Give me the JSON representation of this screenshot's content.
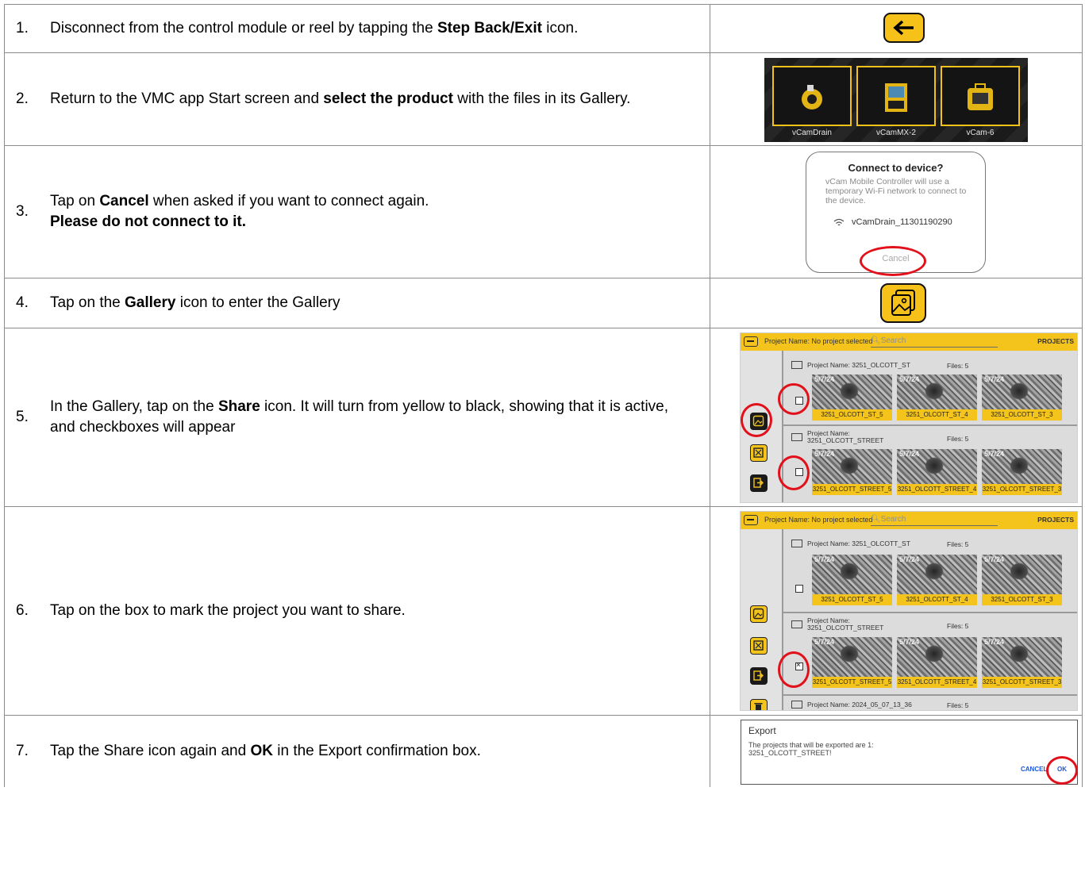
{
  "steps": [
    {
      "num": "1.",
      "text_parts": [
        "Disconnect from the control module or reel by tapping the ",
        "Step Back/Exit",
        " icon."
      ]
    },
    {
      "num": "2.",
      "text_parts": [
        "Return to the VMC app Start screen and ",
        "select the product",
        " with the files in its Gallery."
      ]
    },
    {
      "num": "3.",
      "text_parts": [
        "Tap on ",
        "Cancel",
        " when asked if you want to connect again.",
        "Please do not connect to it."
      ]
    },
    {
      "num": "4.",
      "text_parts": [
        "Tap on the ",
        "Gallery",
        " icon to enter the Gallery"
      ]
    },
    {
      "num": "5.",
      "text_parts": [
        "In the Gallery, tap on the ",
        "Share",
        " icon. It will turn from yellow to black, showing that it is active, and checkboxes will appear"
      ]
    },
    {
      "num": "6.",
      "text": "Tap on the box to mark the project you want to share."
    },
    {
      "num": "7.",
      "text_parts": [
        "Tap the Share icon again and ",
        "OK",
        " in the Export confirmation box."
      ]
    }
  ],
  "products": [
    "vCamDrain",
    "vCamMX-2",
    "vCam-6"
  ],
  "connect_dialog": {
    "title": "Connect to device?",
    "body": "vCam Mobile Controller will use a temporary Wi-Fi network to connect to the device.",
    "network": "vCamDrain_11301190290",
    "cancel": "Cancel"
  },
  "gallery": {
    "header_name": "Project Name: No project selected",
    "search_placeholder": "Search",
    "projects_label": "PROJECTS",
    "date": "5/7/24",
    "project1": {
      "title": "Project Name: 3251_OLCOTT_ST",
      "files": "Files: 5",
      "thumbs": [
        "3251_OLCOTT_ST_5",
        "3251_OLCOTT_ST_4",
        "3251_OLCOTT_ST_3"
      ]
    },
    "project2": {
      "title_line1": "Project Name:",
      "title_line2": "3251_OLCOTT_STREET",
      "files": "Files: 5",
      "thumbs": [
        "3251_OLCOTT_STREET_5",
        "3251_OLCOTT_STREET_4",
        "3251_OLCOTT_STREET_3"
      ]
    },
    "project3": {
      "title": "Project Name: 2024_05_07_13_36",
      "files": "Files: 5"
    }
  },
  "export_dialog": {
    "title": "Export",
    "line1": "The projects that will be exported are 1:",
    "line2": "3251_OLCOTT_STREET!",
    "cancel": "CANCEL",
    "ok": "OK"
  },
  "colors": {
    "accent_yellow": "#f4c41c",
    "highlight_red": "#e2101a",
    "dialog_button_blue": "#1b58d6"
  }
}
